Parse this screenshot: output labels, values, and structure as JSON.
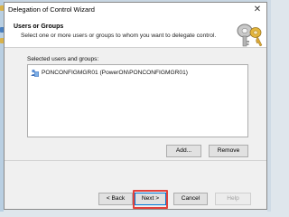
{
  "window": {
    "title": "Delegation of Control Wizard",
    "close_glyph": "✕"
  },
  "header": {
    "title": "Users or Groups",
    "subtitle": "Select one or more users or groups to whom you want to delegate control.",
    "art_icon": "keys-icon"
  },
  "selection": {
    "label": "Selected users and groups:",
    "items": [
      {
        "icon": "user-group-icon",
        "text": "PONCONFIGMGR01 (PowerON\\PONCONFIGMGR01)"
      }
    ]
  },
  "buttons": {
    "add": "Add...",
    "remove": "Remove",
    "back": "< Back",
    "next": "Next >",
    "cancel": "Cancel",
    "help": "Help"
  },
  "colors": {
    "highlight": "#e3413b",
    "focus_border": "#0078d7"
  }
}
